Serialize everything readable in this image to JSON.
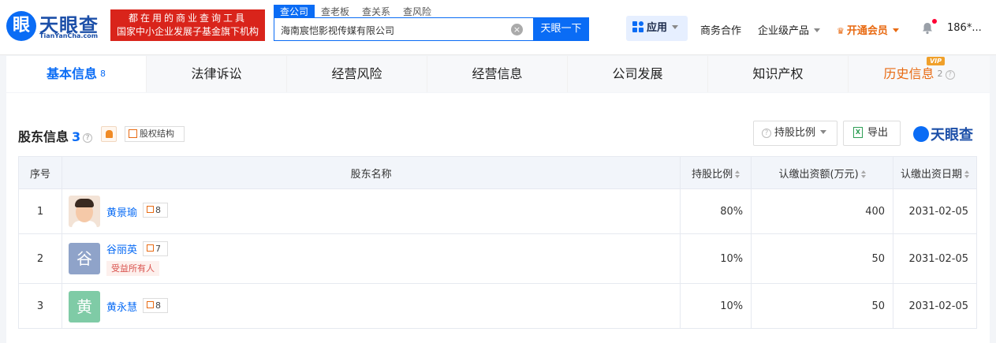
{
  "header": {
    "logo_mark": "眼",
    "logo_text": "天眼查",
    "logo_sub": "TianYanCha.com",
    "slogan_line1": "都在用的商业查询工具",
    "slogan_line2": "国家中小企业发展子基金旗下机构",
    "search_tabs": [
      "查公司",
      "查老板",
      "查关系",
      "查风险"
    ],
    "search_value": "海南宸恺影视传媒有限公司",
    "search_button": "天眼一下",
    "clear_glyph": "×",
    "apps": "应用",
    "nav": [
      "商务合作",
      "企业级产品",
      "开通会员",
      "186*..."
    ]
  },
  "tabs": [
    {
      "label": "基本信息",
      "count": "8"
    },
    {
      "label": "法律诉讼",
      "count": ""
    },
    {
      "label": "经营风险",
      "count": ""
    },
    {
      "label": "经营信息",
      "count": ""
    },
    {
      "label": "公司发展",
      "count": ""
    },
    {
      "label": "知识产权",
      "count": ""
    },
    {
      "label": "历史信息",
      "count": "2"
    }
  ],
  "vip_tag": "VIP",
  "section": {
    "title": "股东信息",
    "count": "3",
    "equity_label": "股权结构",
    "ratio_label": "持股比例",
    "export_label": "导出",
    "watermark": "天眼查",
    "excel_glyph": "X"
  },
  "table": {
    "headers": [
      "序号",
      "股东名称",
      "持股比例",
      "认缴出资额(万元)",
      "认缴出资日期"
    ],
    "rows": [
      {
        "idx": "1",
        "avatar": "",
        "name": "黄景瑜",
        "rel_count": "8",
        "tag": "",
        "ratio": "80%",
        "amount": "400",
        "date": "2031-02-05"
      },
      {
        "idx": "2",
        "avatar": "谷",
        "name": "谷丽英",
        "rel_count": "7",
        "tag": "受益所有人",
        "ratio": "10%",
        "amount": "50",
        "date": "2031-02-05"
      },
      {
        "idx": "3",
        "avatar": "黄",
        "name": "黄永慧",
        "rel_count": "8",
        "tag": "",
        "ratio": "10%",
        "amount": "50",
        "date": "2031-02-05"
      }
    ]
  },
  "colors": {
    "brand_blue": "#0a6cf5",
    "vip_orange": "#e86a12",
    "slogan_red": "#d9241b",
    "avatar_gu": "#8fa3c9",
    "avatar_huang": "#7fcba6"
  }
}
